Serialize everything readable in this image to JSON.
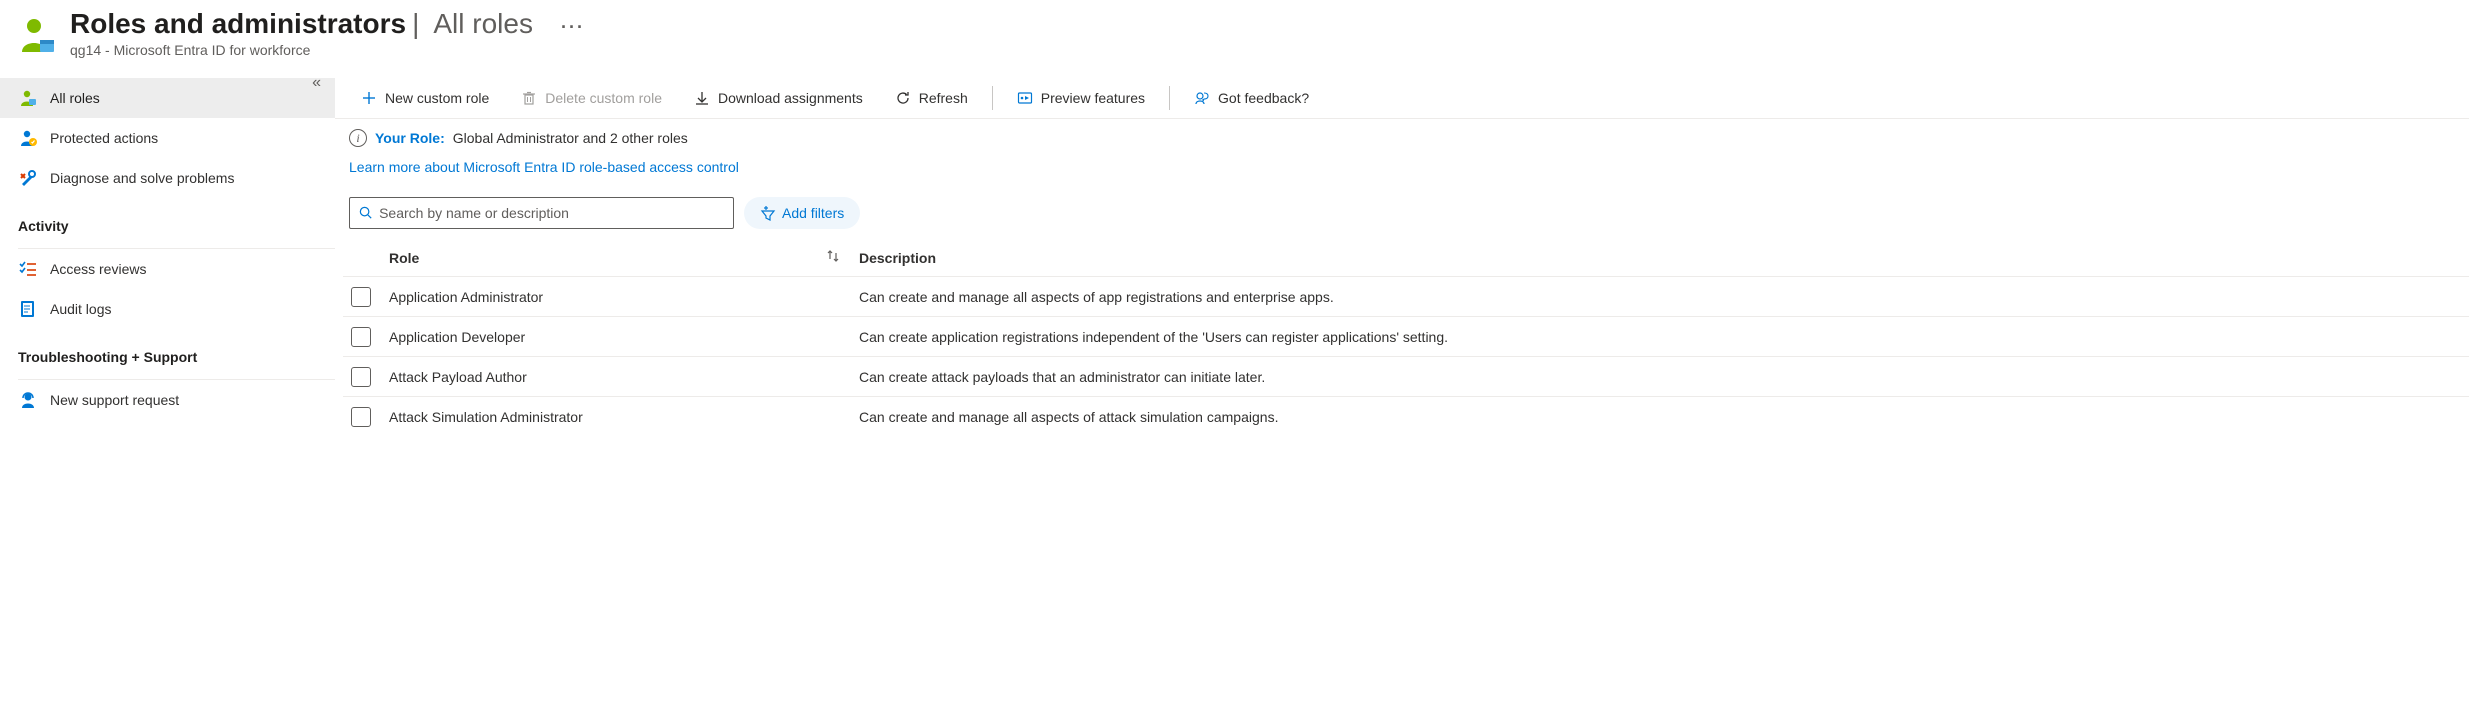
{
  "header": {
    "title": "Roles and administrators",
    "subtitle": "All roles",
    "tenant": "qg14 - Microsoft Entra ID for workforce"
  },
  "sidebar": {
    "items": [
      {
        "label": "All roles",
        "icon": "person",
        "selected": true
      },
      {
        "label": "Protected actions",
        "icon": "shield",
        "selected": false
      },
      {
        "label": "Diagnose and solve problems",
        "icon": "wrench",
        "selected": false
      }
    ],
    "sections": [
      {
        "title": "Activity",
        "items": [
          {
            "label": "Access reviews",
            "icon": "checklist"
          },
          {
            "label": "Audit logs",
            "icon": "doc"
          }
        ]
      },
      {
        "title": "Troubleshooting + Support",
        "items": [
          {
            "label": "New support request",
            "icon": "support"
          }
        ]
      }
    ]
  },
  "toolbar": {
    "new_role": "New custom role",
    "delete_role": "Delete custom role",
    "download": "Download assignments",
    "refresh": "Refresh",
    "preview": "Preview features",
    "feedback": "Got feedback?"
  },
  "info": {
    "your_role_label": "Your Role:",
    "your_role_value": "Global Administrator and 2 other roles",
    "learn_more": "Learn more about Microsoft Entra ID role-based access control"
  },
  "filter": {
    "search_placeholder": "Search by name or description",
    "add_filters": "Add filters"
  },
  "table": {
    "columns": {
      "role": "Role",
      "description": "Description"
    },
    "rows": [
      {
        "role": "Application Administrator",
        "description": "Can create and manage all aspects of app registrations and enterprise apps."
      },
      {
        "role": "Application Developer",
        "description": "Can create application registrations independent of the 'Users can register applications' setting."
      },
      {
        "role": "Attack Payload Author",
        "description": "Can create attack payloads that an administrator can initiate later."
      },
      {
        "role": "Attack Simulation Administrator",
        "description": "Can create and manage all aspects of attack simulation campaigns."
      }
    ]
  }
}
